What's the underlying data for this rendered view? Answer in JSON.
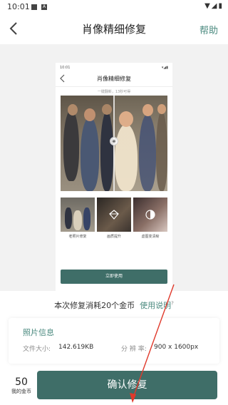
{
  "status_bar": {
    "time": "10:01",
    "icons": [
      "square-icon",
      "a-badge-icon",
      "wifi-icon",
      "signal-icon",
      "battery-icon"
    ]
  },
  "nav": {
    "title": "肖像精细修复",
    "help_label": "帮助",
    "back_icon": "chevron-left-icon"
  },
  "preview": {
    "status_time": "10:01",
    "title": "肖像精细修复",
    "subtitle": "一键翻新，13秒可得",
    "thumbnails": [
      {
        "label": "老照片修复",
        "icon": "none"
      },
      {
        "label": "画质提升",
        "icon": "diamond-icon"
      },
      {
        "label": "虚图变清晰",
        "icon": "contrast-icon"
      }
    ],
    "use_button": "立即使用"
  },
  "cost": {
    "prefix": "本次修复消耗",
    "amount": "20",
    "suffix": "个金币",
    "link": "使用说明"
  },
  "info": {
    "title": "照片信息",
    "size_label": "文件大小:",
    "size_value": "142.619KB",
    "res_label": "分 辨 率:",
    "res_value": "900 x 1600px"
  },
  "footer": {
    "coins": "50",
    "coins_label": "我的金币",
    "confirm_label": "确认修复"
  },
  "colors": {
    "accent": "#4b8a7f",
    "button": "#3f6e68",
    "arrow": "#e0392b"
  }
}
